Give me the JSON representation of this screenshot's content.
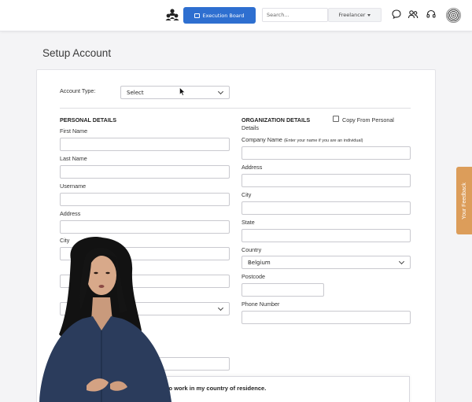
{
  "header": {
    "exec_button_label": "Execution Board",
    "search_placeholder": "Search...",
    "role_dropdown": "Freelancer"
  },
  "page": {
    "title": "Setup Account"
  },
  "form": {
    "account_type_label": "Account Type:",
    "account_type_value": "Select",
    "copy_from_personal": "Copy From Personal",
    "personal": {
      "header": "PERSONAL DETAILS",
      "first_name": "First Name",
      "last_name": "Last Name",
      "username": "Username",
      "address": "Address",
      "city": "City"
    },
    "organization": {
      "header": "ORGANIZATION DETAILS",
      "header_cont": "Details",
      "company_name": "Company Name",
      "company_hint": "(Enter your name if you are an individual)",
      "address": "Address",
      "city": "City",
      "state": "State",
      "country": "Country",
      "country_value": "Belgium",
      "postcode": "Postcode",
      "phone": "Phone Number"
    },
    "notice_text": "to work in my country of residence."
  },
  "feedback_tab": "Your Feedback",
  "colors": {
    "primary": "#2e6fd0",
    "feedback": "#dc9d5a"
  }
}
